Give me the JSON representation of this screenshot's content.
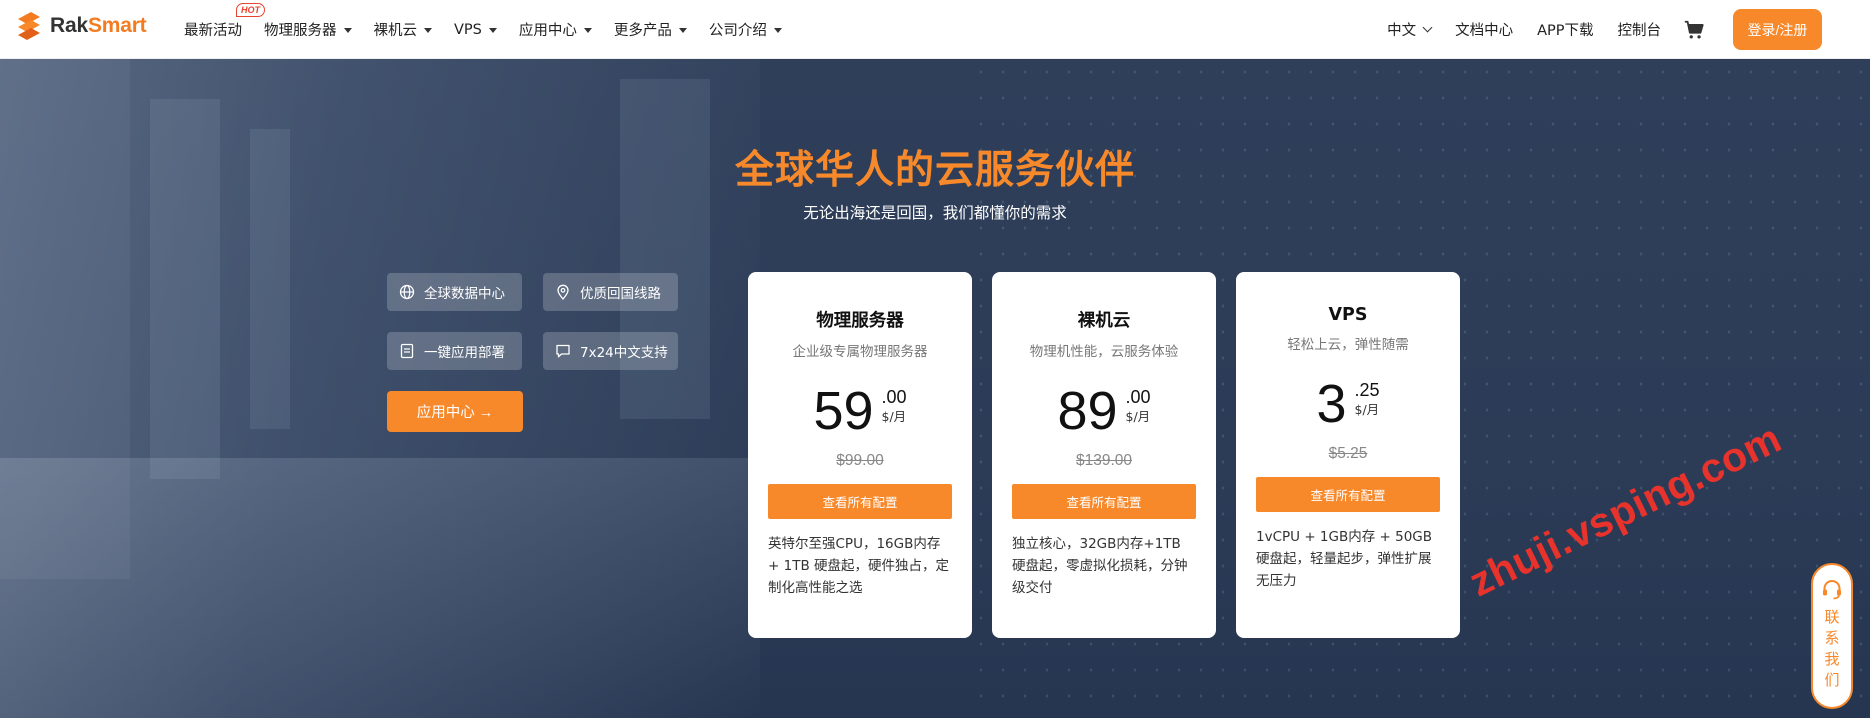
{
  "header": {
    "logo_text_rak": "Rak",
    "logo_text_smart": "Smart",
    "nav": [
      {
        "label": "最新活动",
        "badge": "HOT",
        "has_caret": false
      },
      {
        "label": "物理服务器",
        "has_caret": true
      },
      {
        "label": "裸机云",
        "has_caret": true
      },
      {
        "label": "VPS",
        "has_caret": true
      },
      {
        "label": "应用中心",
        "has_caret": true
      },
      {
        "label": "更多产品",
        "has_caret": true
      },
      {
        "label": "公司介绍",
        "has_caret": true
      }
    ],
    "language": "中文",
    "docs": "文档中心",
    "app_download": "APP下载",
    "console": "控制台",
    "cart_icon": "cart-icon",
    "login": "登录/注册"
  },
  "hero": {
    "title": "全球华人的云服务伙伴",
    "subtitle": "无论出海还是回国，我们都懂你的需求",
    "features": [
      {
        "label": "全球数据中心",
        "icon": "globe-icon"
      },
      {
        "label": "优质回国线路",
        "icon": "location-pin-icon"
      },
      {
        "label": "一键应用部署",
        "icon": "document-icon"
      },
      {
        "label": "7x24中文支持",
        "icon": "chat-icon"
      }
    ],
    "app_center_button": "应用中心 →"
  },
  "plans": [
    {
      "title": "物理服务器",
      "desc": "企业级专属物理服务器",
      "price_int": "59",
      "price_dec": ".00",
      "unit": "$/月",
      "original": "$99.00",
      "button": "查看所有配置",
      "body": "英特尔至强CPU，16GB内存 + 1TB 硬盘起，硬件独占，定制化高性能之选"
    },
    {
      "title": "裸机云",
      "desc": "物理机性能，云服务体验",
      "price_int": "89",
      "price_dec": ".00",
      "unit": "$/月",
      "original": "$139.00",
      "button": "查看所有配置",
      "body": "独立核心，32GB内存+1TB 硬盘起，零虚拟化损耗，分钟级交付"
    },
    {
      "title": "VPS",
      "desc": "轻松上云，弹性随需",
      "price_int": "3",
      "price_dec": ".25",
      "unit": "$/月",
      "original": "$5.25",
      "button": "查看所有配置",
      "body": "1vCPU + 1GB内存 + 50GB 硬盘起，轻量起步，弹性扩展无压力"
    }
  ],
  "watermark": "zhuji.vsping.com",
  "contact": {
    "label": "联系我们",
    "icon": "headset-icon"
  },
  "colors": {
    "accent": "#f7892b",
    "hero_bg": "#2f3f5a",
    "watermark": "#e8322c"
  }
}
